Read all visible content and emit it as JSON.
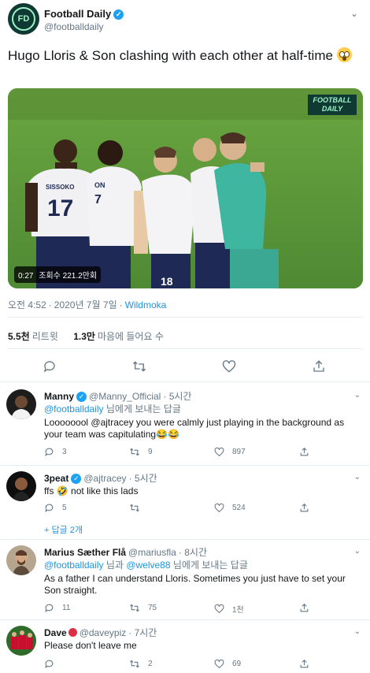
{
  "account": {
    "name": "Football Daily",
    "handle": "@footballdaily",
    "avatar_text": "FD"
  },
  "tweet": {
    "text": "Hugo Lloris & Son clashing with each other at half-time",
    "emoji": "flushed-face-emoji"
  },
  "video": {
    "logo_line1": "FOOTBALL",
    "logo_line2": "DAILY",
    "time": "0:27",
    "views": "조회수 221.2만회",
    "jersey_1": "SISSOKO",
    "jersey_1_num": "17",
    "jersey_2": "ON",
    "jersey_2_num": "7",
    "jersey_3_num": "18"
  },
  "meta": {
    "time": "오전 4:52",
    "date": "2020년 7월 7일",
    "source": "Wildmoka",
    "separator": "·"
  },
  "stats": {
    "retweets_count": "5.5천",
    "retweets_label": "리트윗",
    "likes_count": "1.3만",
    "likes_label": "마음에 들어요 수"
  },
  "replies": [
    {
      "name": "Manny",
      "handle": "@Manny_Official",
      "time": "· 5시간",
      "reply_to": "@footballdaily",
      "reply_to_suffix": " 님에게 보내는 답글",
      "text": "Loooooool @ajtracey you were calmly just playing in the background as your team was capitulating😂😂",
      "replies": "3",
      "retweets": "9",
      "likes": "897"
    },
    {
      "name": "3peat",
      "handle": "@ajtracey",
      "time": "· 5시간",
      "text": "ffs 🤣 not like this lads",
      "replies": "5",
      "retweets": "",
      "likes": "524"
    },
    {
      "name": "Marius Sæther Flå",
      "handle": "@mariusfla",
      "time": "· 8시간",
      "reply_to": "@footballdaily",
      "reply_to_mid": " 님과 ",
      "reply_to_2": "@welve88",
      "reply_to_suffix": " 님에게 보내는 답글",
      "text": "As a father I can understand Lloris. Sometimes you just have to set your Son straight.",
      "replies": "11",
      "retweets": "75",
      "likes": "1천"
    },
    {
      "name": "Dave",
      "handle": "@daveypiz",
      "time": "· 7시간",
      "text": "Please don't leave me",
      "replies": "",
      "retweets": "2",
      "likes": "69"
    }
  ],
  "show_more": "+ 답글 2개",
  "colors": {
    "accent": "#1b95e0",
    "brand": "#0f3a34",
    "brand_light": "#9ff2c7"
  }
}
